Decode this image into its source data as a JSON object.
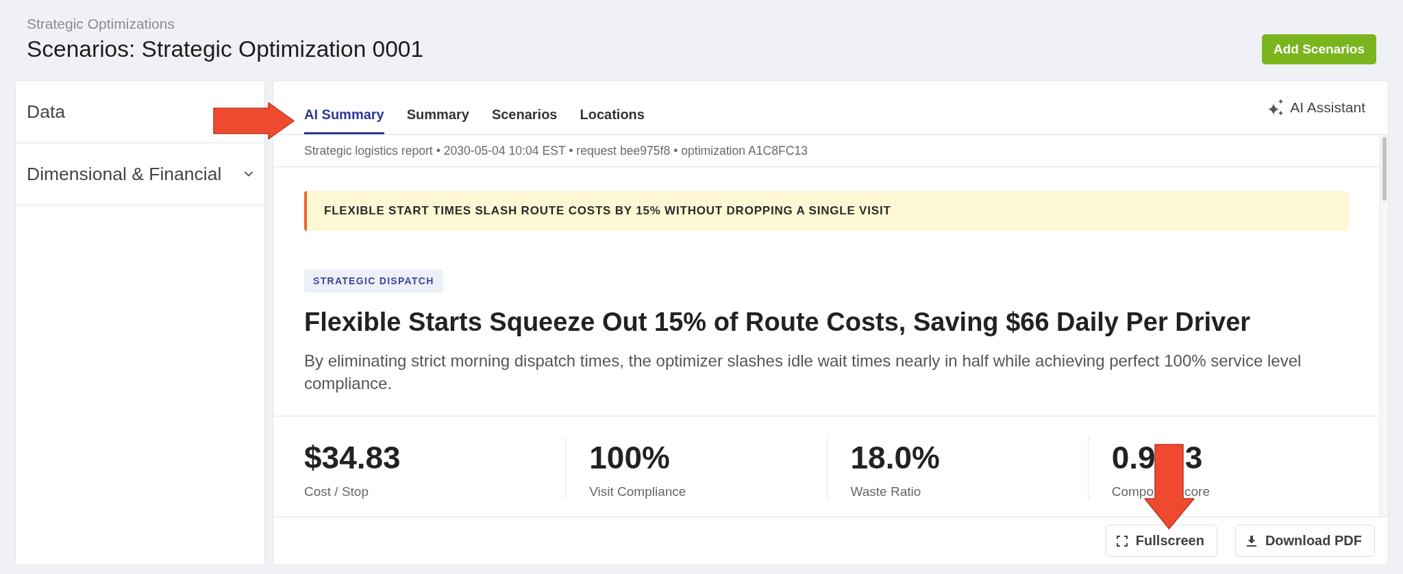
{
  "header": {
    "breadcrumb": "Strategic Optimizations",
    "title": "Scenarios: Strategic Optimization 0001",
    "action": "Add Scenarios"
  },
  "sidebar": {
    "items": [
      {
        "kind": "item",
        "label": "Data"
      },
      {
        "kind": "group",
        "label": "Dimensional & Financial",
        "expanded": false
      }
    ]
  },
  "report": {
    "tabs": [
      {
        "label": "AI Summary",
        "selected": true
      },
      {
        "label": "Summary",
        "selected": false
      },
      {
        "label": "Scenarios",
        "selected": false
      },
      {
        "label": "Locations",
        "selected": false
      }
    ],
    "assistant": "AI Assistant",
    "meta": "Strategic logistics report • 2030-05-04 10:04 EST • request bee975f8 • optimization A1C8FC13",
    "callout": "FLEXIBLE START TIMES SLASH ROUTE COSTS BY 15% WITHOUT DROPPING A SINGLE VISIT",
    "tag": "STRATEGIC DISPATCH",
    "headline": "Flexible Starts Squeeze Out 15% of Route Costs, Saving $66 Daily Per Driver",
    "summary": "By eliminating strict morning dispatch times, the optimizer slashes idle wait times nearly in half while achieving perfect 100% service level compliance.",
    "metrics": [
      {
        "kind": "plain",
        "value": "$34.83",
        "label": "Cost / Stop"
      },
      {
        "kind": "plain",
        "value": "100%",
        "label": "Visit Compliance"
      },
      {
        "kind": "plain",
        "value": "18.0%",
        "label": "Waste Ratio"
      },
      {
        "kind": "covered",
        "value_parts": [
          "0.9",
          "3"
        ],
        "label_parts": [
          "Compo",
          "core"
        ]
      }
    ],
    "footer_buttons": [
      {
        "kind": "fullscreen",
        "label": "Fullscreen"
      },
      {
        "kind": "download",
        "label": "Download PDF"
      }
    ]
  },
  "annotations": [
    {
      "kind": "arrow_right"
    },
    {
      "kind": "arrow_down"
    }
  ]
}
